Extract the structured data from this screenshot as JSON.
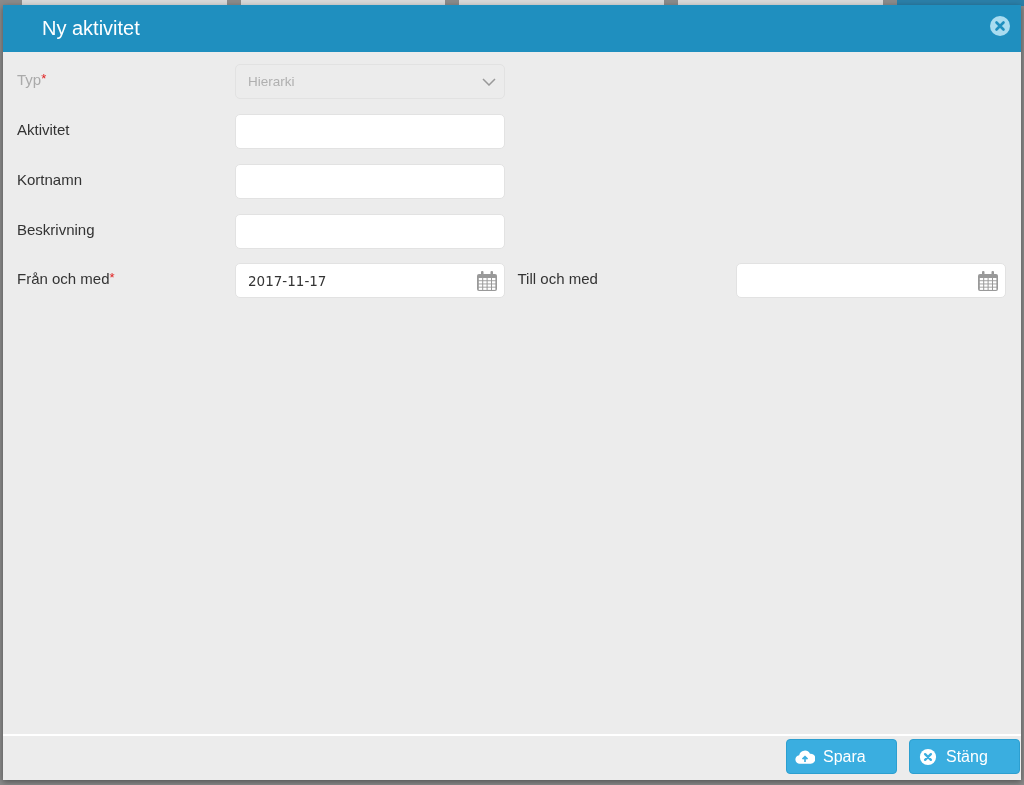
{
  "background_tabs": [
    {
      "selected": false
    },
    {
      "selected": false
    },
    {
      "selected": false
    },
    {
      "selected": false
    },
    {
      "selected": true
    }
  ],
  "dialog": {
    "title": "Ny aktivitet"
  },
  "rows": [
    {
      "fields": [
        {
          "kind": "select",
          "label": "Typ",
          "required": true,
          "disabled": true,
          "value": "Hierarki"
        }
      ]
    },
    {
      "fields": [
        {
          "kind": "text",
          "label": "Aktivitet",
          "required": false,
          "disabled": false
        }
      ]
    },
    {
      "fields": [
        {
          "kind": "text",
          "label": "Kortnamn",
          "required": false,
          "disabled": false
        }
      ]
    },
    {
      "fields": [
        {
          "kind": "text",
          "label": "Beskrivning",
          "required": false,
          "disabled": false
        }
      ]
    },
    {
      "fields": [
        {
          "kind": "date",
          "label": "Från och med",
          "required": true,
          "disabled": false,
          "value": "2017-11-17"
        },
        {
          "kind": "date",
          "label": "Till och med",
          "required": false,
          "disabled": false
        }
      ]
    }
  ],
  "required_mark": "*",
  "buttons": [
    {
      "kind": "save",
      "label": "Spara"
    },
    {
      "kind": "close",
      "label": "Stäng"
    }
  ]
}
